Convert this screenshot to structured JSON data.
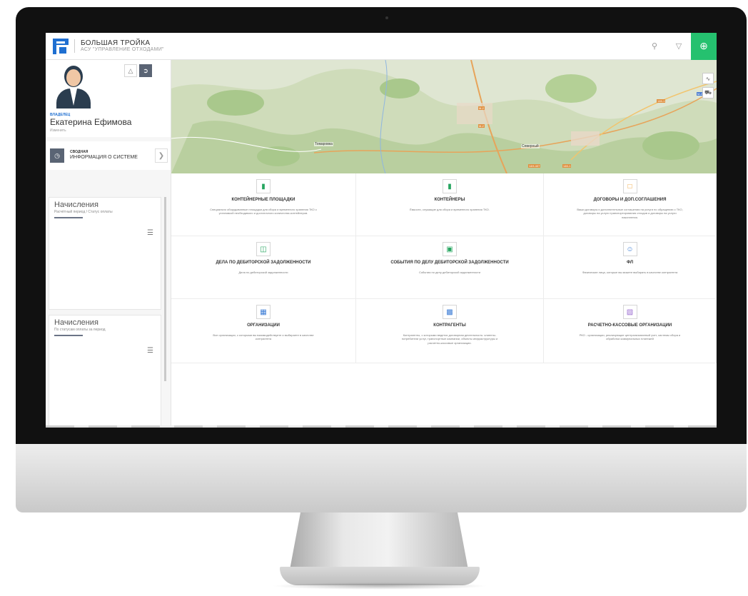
{
  "header": {
    "brand_name": "БОЛЬШАЯ ТРОЙКА",
    "brand_sub": "АСУ \"УПРАВЛЕНИЕ ОТХОДАМИ\"",
    "search_icon": "search-icon",
    "filter_icon": "filter-icon",
    "add_icon": "add-icon",
    "accent_color": "#25c16f"
  },
  "profile": {
    "role": "ВЛАДЕЛЕЦ",
    "name": "Екатерина Ефимова",
    "hint": "Изменить"
  },
  "summary": {
    "line1": "СВОДНАЯ",
    "line2": "ИНФОРМАЦИЯ О СИСТЕМЕ"
  },
  "cards": [
    {
      "title": "Начисления",
      "subtitle": "Расчётный период / Статус оплаты"
    },
    {
      "title": "Начисления",
      "subtitle": "По статусам оплаты за период"
    }
  ],
  "map": {
    "labels": [
      "Томаровка",
      "Северный"
    ],
    "signs": [
      "М-2",
      "М-2",
      "14Н-407",
      "14К-1",
      "14К-1",
      "М-2"
    ]
  },
  "tiles": [
    {
      "title": "КОНТЕЙНЕРНЫЕ ПЛОЩАДКИ",
      "desc": "Специально оборудованные площадки для сбора и временного хранения ТКО с установкой необходимого и достаточного количества контейнеров."
    },
    {
      "title": "КОНТЕЙНЕРЫ",
      "desc": "Ёмкости, служащие для сбора и временного хранения ТКО."
    },
    {
      "title": "ДОГОВОРЫ И ДОП.СОГЛАШЕНИЯ",
      "desc": "Ваши договоры и дополнительные соглашения на услуги по обращению с ТКО, договоры на услуги транспортирования отходов и договоры на услуги накопления."
    },
    {
      "title": "ДЕЛА ПО ДЕБИТОРСКОЙ ЗАДОЛЖЕННОСТИ",
      "desc": "Дела по дебиторской задолженности"
    },
    {
      "title": "СОБЫТИЯ ПО ДЕЛУ ДЕБИТОРСКОЙ ЗАДОЛЖЕННОСТИ",
      "desc": "События по делу дебиторской задолженности"
    },
    {
      "title": "ФЛ",
      "desc": "Физические лица, которые вы можете выбирать в качестве контрагента"
    },
    {
      "title": "ОРГАНИЗАЦИИ",
      "desc": "Все организации, с которыми вы взаимодействуете и выбираете в качестве контрагента"
    },
    {
      "title": "КОНТРАГЕНТЫ",
      "desc": "Контрагенты, с которыми ведется договорная деятельность: клиенты-потребители услуг, транспортные компании, объекты инфраструктуры и расчетно-кассовые организации."
    },
    {
      "title": "РАСЧЕТНО-КАССОВЫЕ ОРГАНИЗАЦИИ",
      "desc": "РКО - организации, реализующие централизованный учет, системы сбора и обработки коммунальных платежей"
    }
  ]
}
